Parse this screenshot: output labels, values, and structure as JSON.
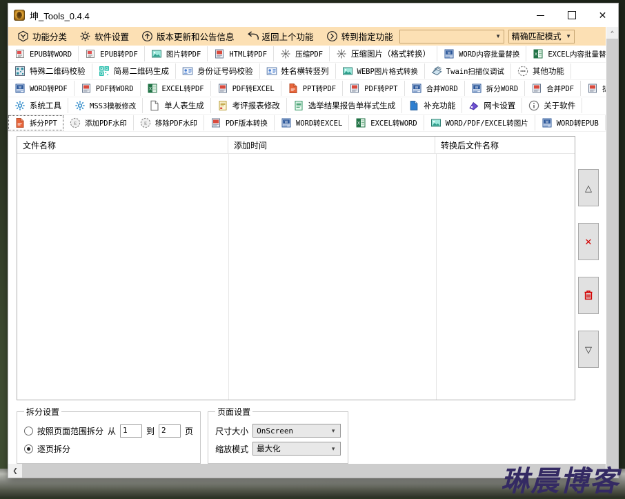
{
  "window": {
    "title": "坤_Tools_0.4.4",
    "app_icon": "app-logo-icon",
    "controls": {
      "minimize": "—",
      "maximize": "□",
      "close": "✕"
    }
  },
  "menubar": {
    "items": [
      {
        "label": "功能分类",
        "icon": "category-icon"
      },
      {
        "label": "软件设置",
        "icon": "gear-icon"
      },
      {
        "label": "版本更新和公告信息",
        "icon": "arrow-up-circle-icon"
      },
      {
        "label": "返回上个功能",
        "icon": "back-arrow-icon"
      },
      {
        "label": "转到指定功能",
        "icon": "arrow-right-circle-icon"
      }
    ],
    "search": {
      "value": "",
      "placeholder": ""
    },
    "match_mode": {
      "value": "精确匹配模式"
    }
  },
  "toolbar": {
    "rows": [
      [
        {
          "label": "EPUB转WORD",
          "icon": "epub-file-icon",
          "mono": true
        },
        {
          "label": "EPUB转PDF",
          "icon": "epub-file-icon",
          "mono": true
        },
        {
          "label": "图片转PDF",
          "icon": "image-icon",
          "mono": true
        },
        {
          "label": "HTML转PDF",
          "icon": "html-file-icon",
          "mono": true
        },
        {
          "label": "压缩PDF",
          "icon": "compress-icon",
          "mono": true
        },
        {
          "label": "压缩图片（格式转换）",
          "icon": "compress-icon",
          "mono": false
        },
        {
          "label": "WORD内容批量替换",
          "icon": "word-file-icon",
          "mono": true
        },
        {
          "label": "EXCEL内容批量替换",
          "icon": "excel-file-icon",
          "mono": true
        }
      ],
      [
        {
          "label": "特殊二维码校验",
          "icon": "qrcode-icon",
          "mono": false
        },
        {
          "label": "简易二维码生成",
          "icon": "qrcode-grid-icon",
          "mono": false
        },
        {
          "label": "身份证号码校验",
          "icon": "id-card-icon",
          "mono": false
        },
        {
          "label": "姓名横转竖列",
          "icon": "person-card-icon",
          "mono": false
        },
        {
          "label": "WEBP图片格式转换",
          "icon": "image-icon",
          "mono": true
        },
        {
          "label": "Twain扫描仪调试",
          "icon": "scanner-icon",
          "mono": true
        },
        {
          "label": "其他功能",
          "icon": "dots-circle-icon",
          "mono": false
        }
      ],
      [
        {
          "label": "WORD转PDF",
          "icon": "word-file-icon",
          "mono": true
        },
        {
          "label": "PDF转WORD",
          "icon": "pdf-file-icon",
          "mono": true
        },
        {
          "label": "EXCEL转PDF",
          "icon": "excel-file-icon",
          "mono": true
        },
        {
          "label": "PDF转EXCEL",
          "icon": "pdf-file-icon",
          "mono": true
        },
        {
          "label": "PPT转PDF",
          "icon": "ppt-file-icon",
          "mono": true
        },
        {
          "label": "PDF转PPT",
          "icon": "pdf-file-icon",
          "mono": true
        },
        {
          "label": "合并WORD",
          "icon": "word-file-icon",
          "mono": true
        },
        {
          "label": "拆分WORD",
          "icon": "word-file-icon",
          "mono": true
        },
        {
          "label": "合并PDF",
          "icon": "pdf-file-icon",
          "mono": true
        },
        {
          "label": "拆分PDF",
          "icon": "pdf-file-icon",
          "mono": true
        }
      ],
      [
        {
          "label": "系统工具",
          "icon": "gear-blue-icon",
          "mono": false
        },
        {
          "label": "MSS3模板修改",
          "icon": "gear-blue-icon",
          "mono": true
        },
        {
          "label": "单人表生成",
          "icon": "page-icon",
          "mono": false
        },
        {
          "label": "考评报表修改",
          "icon": "report-icon",
          "mono": false
        },
        {
          "label": "选举结果报告单样式生成",
          "icon": "report-green-icon",
          "mono": false
        },
        {
          "label": "补充功能",
          "icon": "blue-page-icon",
          "mono": false
        },
        {
          "label": "网卡设置",
          "icon": "network-icon",
          "mono": false
        },
        {
          "label": "关于软件",
          "icon": "info-circle-icon",
          "mono": false
        }
      ],
      [
        {
          "label": "拆分PPT",
          "icon": "ppt-file-icon",
          "mono": true,
          "active": true
        },
        {
          "label": "添加PDF水印",
          "icon": "watermark-icon",
          "mono": true
        },
        {
          "label": "移除PDF水印",
          "icon": "watermark-icon",
          "mono": true
        },
        {
          "label": "PDF版本转换",
          "icon": "pdf-file-icon",
          "mono": true
        },
        {
          "label": "WORD转EXCEL",
          "icon": "word-file-icon",
          "mono": true
        },
        {
          "label": "EXCEL转WORD",
          "icon": "excel-file-icon",
          "mono": true
        },
        {
          "label": "WORD/PDF/EXCEL转图片",
          "icon": "image-icon",
          "mono": true
        },
        {
          "label": "WORD转EPUB",
          "icon": "word-file-icon",
          "mono": true
        }
      ]
    ]
  },
  "filelist": {
    "columns": [
      "文件名称",
      "添加时间",
      "转换后文件名称"
    ],
    "rows": []
  },
  "side_tools": [
    {
      "name": "move-up-button",
      "glyph": "△",
      "color": "dark"
    },
    {
      "name": "remove-button",
      "glyph": "✕",
      "color": "red"
    },
    {
      "name": "clear-all-button",
      "glyph": "🗑",
      "color": "red"
    },
    {
      "name": "move-down-button",
      "glyph": "▽",
      "color": "dark"
    }
  ],
  "split_settings": {
    "legend": "拆分设置",
    "range_option": {
      "label": "按照页面范围拆分",
      "checked": false
    },
    "from_label": "从",
    "from_value": "1",
    "to_label": "到",
    "to_value": "2",
    "page_unit": "页",
    "per_page_option": {
      "label": "逐页拆分",
      "checked": true
    }
  },
  "page_settings": {
    "legend": "页面设置",
    "size_label": "尺寸大小",
    "size_value": "OnScreen",
    "zoom_label": "缩放模式",
    "zoom_value": "最大化"
  },
  "watermark": "琳晨博客",
  "colors": {
    "menubar_bg": "#fce0b4",
    "accent_red": "#d40000",
    "watermark": "#342a63"
  }
}
